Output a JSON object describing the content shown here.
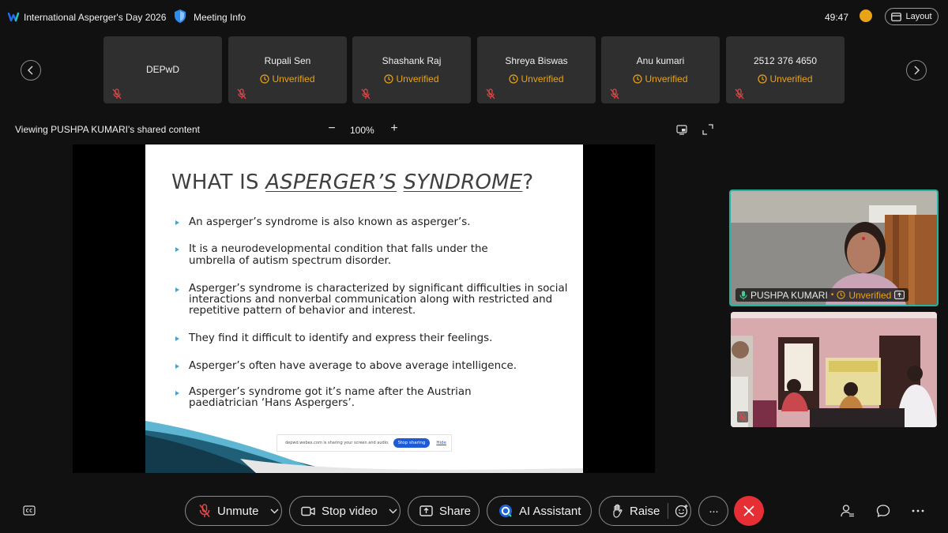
{
  "header": {
    "meeting_title": "International Asperger's Day 2026",
    "info_label": "Meeting Info",
    "timer": "49:47",
    "layout_label": "Layout",
    "colors": {
      "webex_blue": "#1f6ff0",
      "status_orange": "#e8a317"
    }
  },
  "participants": [
    {
      "name": "DEPwD",
      "status": ""
    },
    {
      "name": "Rupali Sen",
      "status": "Unverified"
    },
    {
      "name": "Shashank Raj",
      "status": "Unverified"
    },
    {
      "name": "Shreya Biswas",
      "status": "Unverified"
    },
    {
      "name": "Anu kumari",
      "status": "Unverified"
    },
    {
      "name": "2512 376 4650",
      "status": "Unverified"
    }
  ],
  "share": {
    "caption": "Viewing PUSHPA KUMARI's shared content",
    "zoom_out": "−",
    "zoom_level": "100%",
    "zoom_in": "+"
  },
  "slide": {
    "title_prefix": "WHAT IS ",
    "title_word1": "ASPERGER’S",
    "title_space": " ",
    "title_word2": "SYNDROME",
    "title_suffix": "?",
    "bullets": [
      "An asperger’s syndrome is also known as asperger’s.",
      "It is a neurodevelopmental condition that falls under the umbrella of autism spectrum disorder.",
      "Asperger’s syndrome is characterized by significant difficulties in social interactions and nonverbal communication along with restricted and repetitive pattern of behavior and interest.",
      "They find it difficult to identify and express their feelings.",
      "Asperger’s often have average to above average intelligence.",
      "Asperger’s syndrome got it’s name after the Austrian paediatrician ‘Hans Aspergers’."
    ],
    "banner_text": "depwd.webex.com is sharing your screen and audio.",
    "banner_stop": "Stop sharing",
    "banner_hide": "Hide"
  },
  "active_speaker": {
    "name": "PUSHPA KUMARI",
    "status": "Unverified"
  },
  "controls": {
    "unmute": "Unmute",
    "stop_video": "Stop video",
    "share": "Share",
    "ai_assistant": "AI Assistant",
    "raise": "Raise",
    "more": "···",
    "leave_color": "#e52f35"
  }
}
